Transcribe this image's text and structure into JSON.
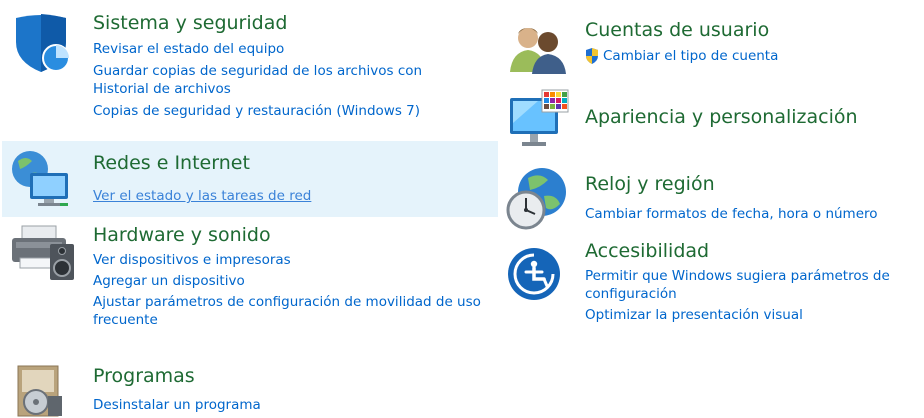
{
  "left": [
    {
      "title": "Sistema y seguridad",
      "icon": "security-shield-icon",
      "links": [
        "Revisar el estado del equipo",
        "Guardar copias de seguridad de los archivos con Historial de archivos",
        "Copias de seguridad y restauración (Windows 7)"
      ]
    },
    {
      "title": "Redes e Internet",
      "icon": "network-globe-icon",
      "links": [
        "Ver el estado y las tareas de red"
      ]
    },
    {
      "title": "Hardware y sonido",
      "icon": "printer-speaker-icon",
      "links": [
        "Ver dispositivos e impresoras",
        "Agregar un dispositivo",
        "Ajustar parámetros de configuración de movilidad de uso frecuente"
      ]
    },
    {
      "title": "Programas",
      "icon": "programs-disc-icon",
      "links": [
        "Desinstalar un programa"
      ]
    }
  ],
  "right": [
    {
      "title": "Cuentas de usuario",
      "icon": "users-icon",
      "links": [
        "Cambiar el tipo de cuenta"
      ]
    },
    {
      "title": "Apariencia y personalización",
      "icon": "monitor-palette-icon",
      "links": []
    },
    {
      "title": "Reloj y región",
      "icon": "clock-globe-icon",
      "links": [
        "Cambiar formatos de fecha, hora o número"
      ]
    },
    {
      "title": "Accesibilidad",
      "icon": "accessibility-icon",
      "links": [
        "Permitir que Windows sugiera parámetros de configuración",
        "Optimizar la presentación visual"
      ]
    }
  ],
  "colors": {
    "title": "#1e6a33",
    "link": "#0066cc",
    "hover_bg": "#e5f3fb"
  }
}
